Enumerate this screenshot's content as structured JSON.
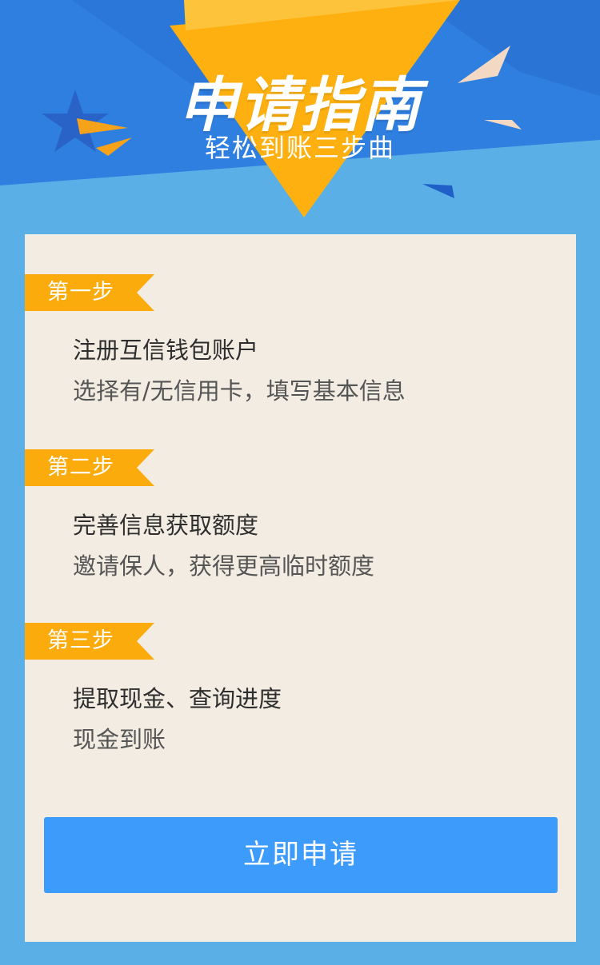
{
  "header": {
    "title": "申请指南",
    "subtitle": "轻松到账三步曲"
  },
  "steps": [
    {
      "tag": "第一步",
      "title": "注册互信钱包账户",
      "description": "选择有/无信用卡，填写基本信息"
    },
    {
      "tag": "第二步",
      "title": "完善信息获取额度",
      "description": "邀请保人，获得更高临时额度"
    },
    {
      "tag": "第三步",
      "title": "提取现金、查询进度",
      "description": "现金到账"
    }
  ],
  "apply_button": {
    "label": "立即申请"
  },
  "colors": {
    "page_background": "#5ab0e6",
    "header_blue": "#2f7fe0",
    "accent_orange": "#fbab0b",
    "card_background": "#f2ece3",
    "button_blue": "#3d9bfb"
  }
}
